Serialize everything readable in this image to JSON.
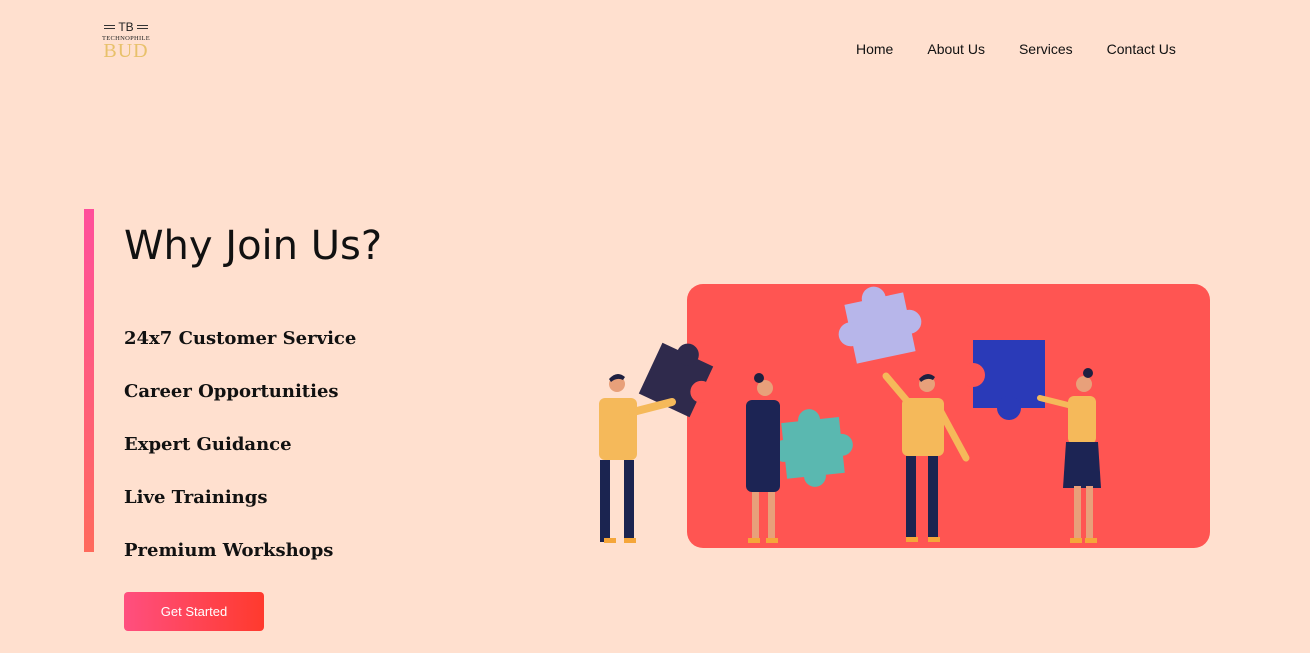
{
  "logo": {
    "initials": "TB",
    "tagline": "TECHNOPHILE",
    "name": "BUD"
  },
  "nav": {
    "items": [
      {
        "label": "Home"
      },
      {
        "label": "About Us"
      },
      {
        "label": "Services"
      },
      {
        "label": "Contact Us"
      }
    ]
  },
  "hero": {
    "title": "Why Join Us?",
    "features": [
      {
        "label": "24x7 Customer Service"
      },
      {
        "label": "Career Opportunities"
      },
      {
        "label": "Expert Guidance"
      },
      {
        "label": "Live Trainings"
      },
      {
        "label": "Premium Workshops"
      }
    ],
    "cta_label": "Get Started"
  },
  "colors": {
    "background": "#ffe0cf",
    "accent_gradient": [
      "#ff4f9b",
      "#ff6a5c"
    ],
    "button_gradient": [
      "#ff4f7f",
      "#ff3a2d"
    ],
    "illustration_panel": "#ff5552"
  },
  "illustration": {
    "icon": "teamwork-puzzle-illustration"
  }
}
